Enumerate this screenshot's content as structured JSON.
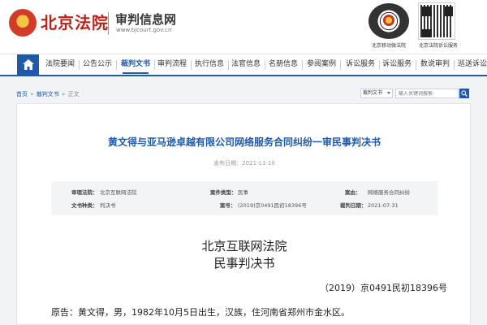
{
  "header": {
    "site_title": "北京法院",
    "subtitle": "审判信息网",
    "url": "www.bjcourt.gov.cn",
    "qr_left_caption": "北京移动微法院",
    "qr_right_caption": "北京法院诉讼服务",
    "emblem_icon": "court-emblem-icon"
  },
  "nav": {
    "home_icon": "home-icon",
    "items": [
      "法院要闻",
      "公告公示",
      "裁判文书",
      "审判流程",
      "执行信息",
      "法官信息",
      "名册信息",
      "参阅案例",
      "诉讼服务",
      "诉讼服务",
      "数说审判",
      "巡送诉讼"
    ],
    "active_index": 2
  },
  "breadcrumb": {
    "home": "首页",
    "sep1": " » ",
    "section": "裁判文书",
    "sep2": " » ",
    "current": "正文"
  },
  "search": {
    "category": "裁判文书",
    "placeholder": "输入关键词搜索",
    "icon": "search-icon"
  },
  "document": {
    "title": "黄文得与亚马逊卓越有限公司网络服务合同纠纷一审民事判决书",
    "published": "发布日期：2021-11-10",
    "meta": {
      "court_label": "审理法院：",
      "court_value": "北京互联网法院",
      "case_type_label": "案件类型：",
      "case_type_value": "民事",
      "cause_label": "案由：",
      "cause_value": "网络服务合同纠纷",
      "doc_type_label": "文书种类：",
      "doc_type_value": "判决书",
      "case_no_label": "案号：",
      "case_no_value": "(2019)京0491民初18396号",
      "date_label": "裁判日期：",
      "date_value": "2021-07-31"
    },
    "court_name": "北京互联网法院",
    "judgment_type": "民事判决书",
    "case_number": "（2019）京0491民初18396号",
    "plaintiff_line": "原告：黄文得，男，1982年10月5日出生，汉族，住河南省郑州市金水区。"
  },
  "colors": {
    "brand_red": "#b5231b",
    "nav_blue": "#1e5aa8",
    "meta_bg": "#f2f4f7"
  }
}
